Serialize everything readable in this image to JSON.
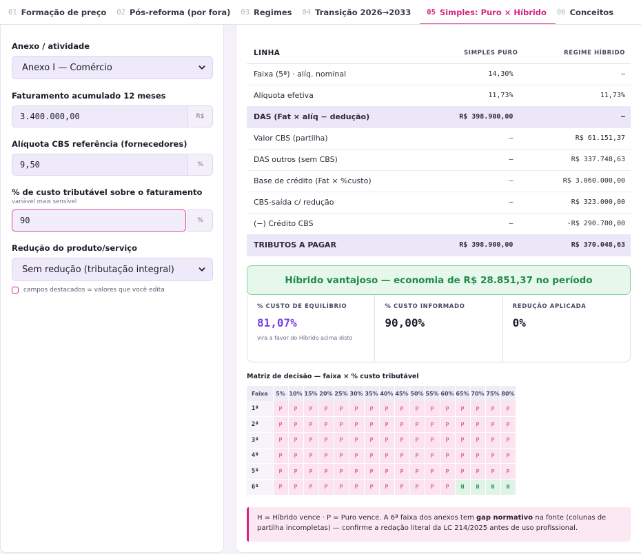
{
  "tabs": [
    {
      "num": "01",
      "label": "Formação de preço",
      "active": false
    },
    {
      "num": "02",
      "label": "Pós-reforma (por fora)",
      "active": false
    },
    {
      "num": "03",
      "label": "Regimes",
      "active": false
    },
    {
      "num": "04",
      "label": "Transição 2026→2033",
      "active": false
    },
    {
      "num": "05",
      "label": "Simples: Puro × Híbrido",
      "active": true
    },
    {
      "num": "06",
      "label": "Conceitos",
      "active": false
    }
  ],
  "form": {
    "anexo_label": "Anexo / atividade",
    "anexo_value": "Anexo I — Comércio",
    "fat_label": "Faturamento acumulado 12 meses",
    "fat_value": "3.400.000,00",
    "fat_unit": "R$",
    "cbs_label": "Alíquota CBS referência (fornecedores)",
    "cbs_value": "9,50",
    "cbs_unit": "%",
    "custo_label": "% de custo tributável sobre o faturamento",
    "custo_sublabel": "variável mais sensível",
    "custo_value": "90",
    "custo_unit": "%",
    "reducao_label": "Redução do produto/serviço",
    "reducao_value": "Sem redução (tributação integral)",
    "legend": "campos destacados = valores que você edita"
  },
  "comparison": {
    "headers": [
      "LINHA",
      "SIMPLES PURO",
      "REGIME HÍBRIDO"
    ],
    "rows": [
      {
        "label": "Faixa (5ª) · alíq. nominal",
        "puro": "14,30%",
        "hibrido": "–",
        "hl": false
      },
      {
        "label": "Alíquota efetiva",
        "puro": "11,73%",
        "hibrido": "11,73%",
        "hl": false
      },
      {
        "label": "DAS (Fat × alíq − dedução)",
        "puro": "R$ 398.900,00",
        "hibrido": "–",
        "hl": true
      },
      {
        "label": "Valor CBS (partilha)",
        "puro": "–",
        "hibrido": "R$ 61.151,37",
        "hl": false
      },
      {
        "label": "DAS outros (sem CBS)",
        "puro": "–",
        "hibrido": "R$ 337.748,63",
        "hl": false
      },
      {
        "label": "Base de crédito (Fat × %custo)",
        "puro": "–",
        "hibrido": "R$ 3.060.000,00",
        "hl": false
      },
      {
        "label": "CBS-saída c/ redução",
        "puro": "–",
        "hibrido": "R$ 323.000,00",
        "hl": false
      },
      {
        "label": "(−) Crédito CBS",
        "puro": "–",
        "hibrido": "-R$ 290.700,00",
        "hl": false
      },
      {
        "label": "TRIBUTOS A PAGAR",
        "puro": "R$ 398.900,00",
        "hibrido": "R$ 370.048,63",
        "hl": true
      }
    ]
  },
  "banner": "Híbrido vantajoso — economia de R$ 28.851,37 no período",
  "stats": [
    {
      "title": "% CUSTO DE EQUILÍBRIO",
      "value": "81,07%",
      "note": "vira a favor do Híbrido acima disto",
      "purple": true
    },
    {
      "title": "% CUSTO INFORMADO",
      "value": "90,00%",
      "note": "",
      "purple": false
    },
    {
      "title": "REDUÇÃO APLICADA",
      "value": "0%",
      "note": "",
      "purple": false
    }
  ],
  "matrix": {
    "title": "Matriz de decisão — faixa × % custo tributável",
    "corner": "Faixa",
    "columns": [
      "5%",
      "10%",
      "15%",
      "20%",
      "25%",
      "30%",
      "35%",
      "40%",
      "45%",
      "50%",
      "55%",
      "60%",
      "65%",
      "70%",
      "75%",
      "80%"
    ],
    "rows": [
      {
        "faixa": "1ª",
        "cells": [
          "P",
          "P",
          "P",
          "P",
          "P",
          "P",
          "P",
          "P",
          "P",
          "P",
          "P",
          "P",
          "P",
          "P",
          "P",
          "P"
        ]
      },
      {
        "faixa": "2ª",
        "cells": [
          "P",
          "P",
          "P",
          "P",
          "P",
          "P",
          "P",
          "P",
          "P",
          "P",
          "P",
          "P",
          "P",
          "P",
          "P",
          "P"
        ]
      },
      {
        "faixa": "3ª",
        "cells": [
          "P",
          "P",
          "P",
          "P",
          "P",
          "P",
          "P",
          "P",
          "P",
          "P",
          "P",
          "P",
          "P",
          "P",
          "P",
          "P"
        ]
      },
      {
        "faixa": "4ª",
        "cells": [
          "P",
          "P",
          "P",
          "P",
          "P",
          "P",
          "P",
          "P",
          "P",
          "P",
          "P",
          "P",
          "P",
          "P",
          "P",
          "P"
        ]
      },
      {
        "faixa": "5ª",
        "cells": [
          "P",
          "P",
          "P",
          "P",
          "P",
          "P",
          "P",
          "P",
          "P",
          "P",
          "P",
          "P",
          "P",
          "P",
          "P",
          "P"
        ]
      },
      {
        "faixa": "6ª",
        "cells": [
          "P",
          "P",
          "P",
          "P",
          "P",
          "P",
          "P",
          "P",
          "P",
          "P",
          "P",
          "P",
          "H",
          "H",
          "H",
          "H"
        ]
      }
    ]
  },
  "note": {
    "pre": "H = Híbrido vence · P = Puro vence. A 6ª faixa dos anexos tem ",
    "bold": "gap normativo",
    "post": " na fonte (colunas de partilha incompletas) — confirme a redação literal da LC 214/2025 antes de uso profissional."
  },
  "colors": {
    "accent": "#d6247f",
    "purple": "#7b3fe4",
    "green": "#1f8a47"
  }
}
